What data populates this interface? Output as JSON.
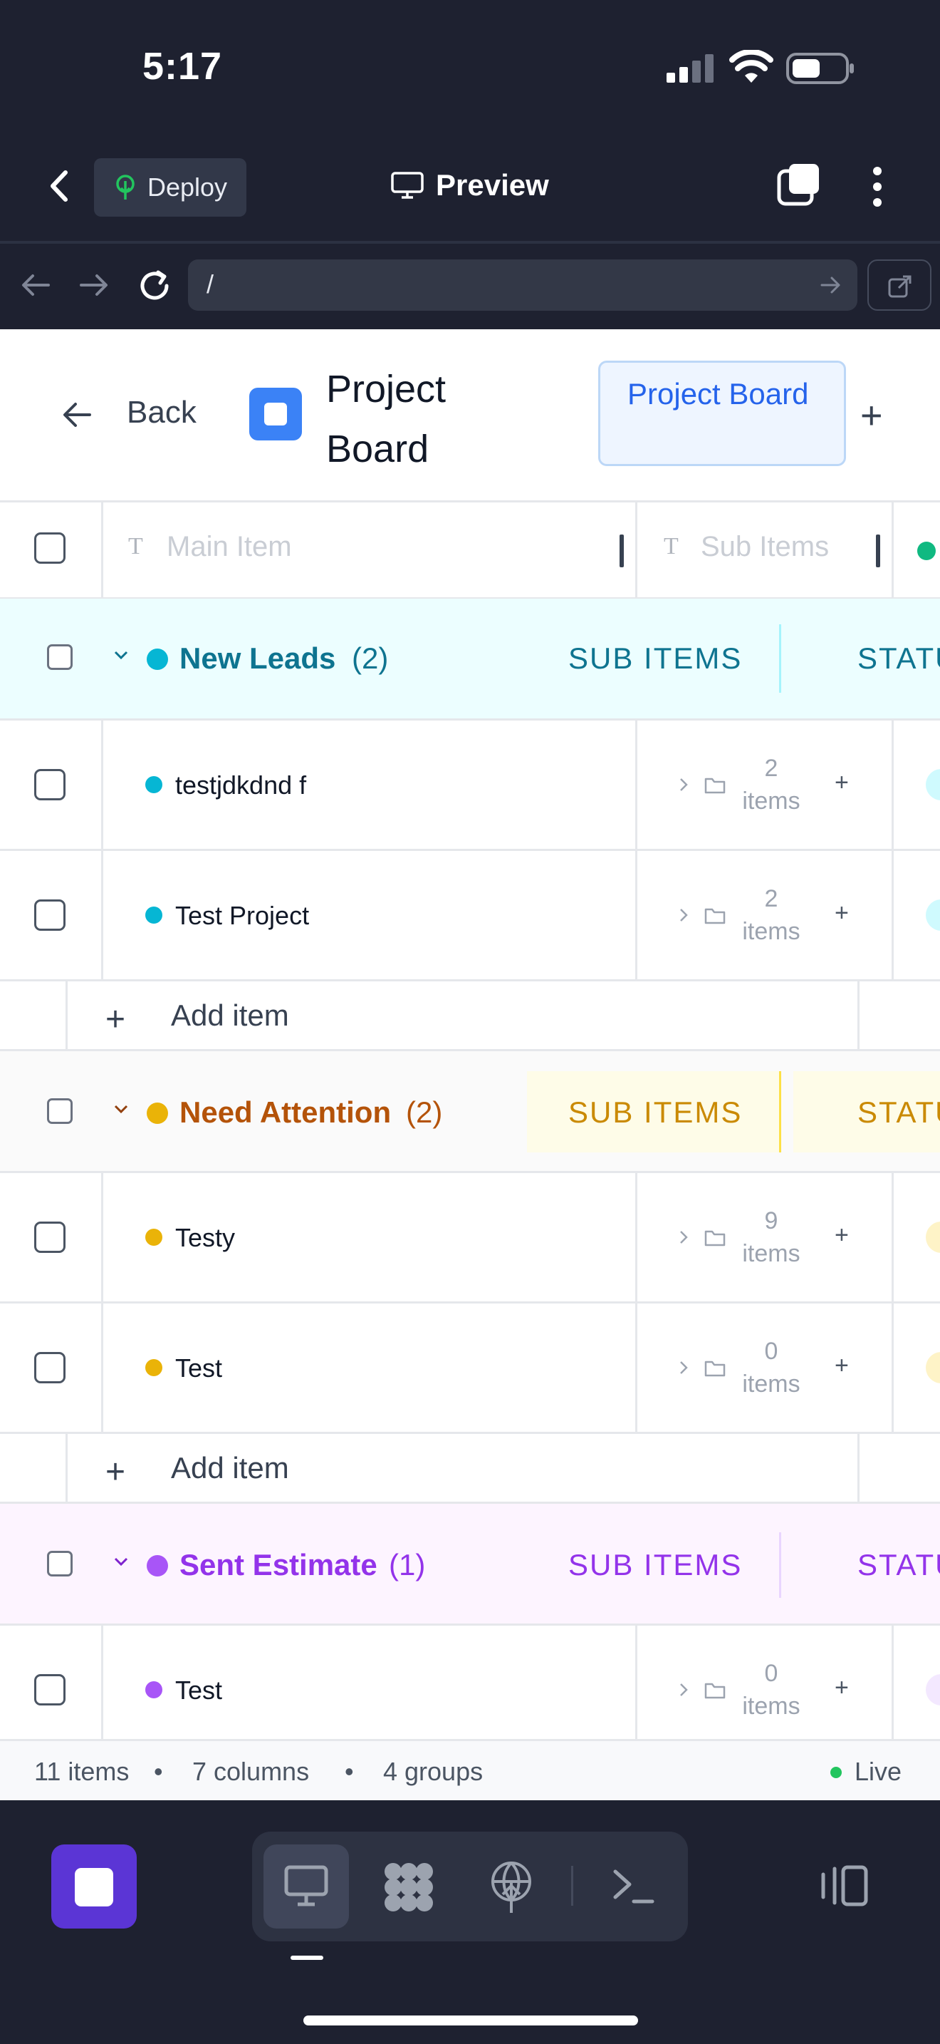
{
  "status_bar": {
    "time": "5:17"
  },
  "app_header": {
    "deploy_label": "Deploy",
    "preview_label": "Preview"
  },
  "browser": {
    "url": "/"
  },
  "board": {
    "back_label": "Back",
    "title": "Project Board",
    "tab_label": "Project Board",
    "columns": {
      "main_item": "Main Item",
      "sub_items": "Sub Items"
    }
  },
  "groups": [
    {
      "name": "New Leads",
      "count": "(2)",
      "color": "#0891b2",
      "dot": "#06b6d4",
      "bg": "#ecfeff",
      "sub_items_tag": "SUB ITEMS",
      "status_tag": "STATU",
      "items": [
        {
          "name": "testjdkdnd f",
          "sub_count": "2",
          "sub_unit": "items"
        },
        {
          "name": "Test Project",
          "sub_count": "2",
          "sub_unit": "items"
        }
      ],
      "add_label": "Add item"
    },
    {
      "name": "Need Attention",
      "count": "(2)",
      "color": "#b7791f",
      "dot": "#eab308",
      "bg": "#fafafa",
      "sub_items_tag": "SUB ITEMS",
      "status_tag": "STATU",
      "items": [
        {
          "name": "Testy",
          "sub_count": "9",
          "sub_unit": "items"
        },
        {
          "name": "Test",
          "sub_count": "0",
          "sub_unit": "items"
        }
      ],
      "add_label": "Add item"
    },
    {
      "name": "Sent Estimate",
      "count": "(1)",
      "color": "#9333ea",
      "dot": "#a855f7",
      "bg": "#fdf4ff",
      "sub_items_tag": "SUB ITEMS",
      "status_tag": "STATU",
      "items": [
        {
          "name": "Test",
          "sub_count": "0",
          "sub_unit": "items"
        }
      ]
    }
  ],
  "footer": {
    "items": "11 items",
    "columns": "7 columns",
    "groups": "4 groups",
    "live": "Live",
    "sep": "•"
  }
}
